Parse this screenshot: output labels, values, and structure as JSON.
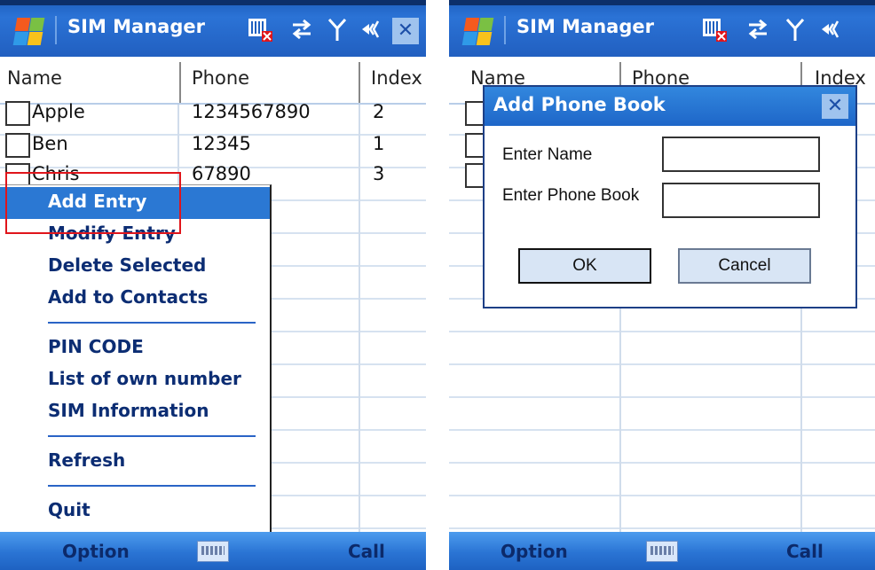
{
  "app_title": "SIM Manager",
  "columns": [
    "Name",
    "Phone",
    "Index"
  ],
  "rows": [
    {
      "name": "Apple",
      "phone": "1234567890",
      "index": "2"
    },
    {
      "name": "Ben",
      "phone": "12345",
      "index": "1"
    },
    {
      "name": "Chris",
      "phone": "67890",
      "index": "3"
    }
  ],
  "menu": {
    "items": [
      "Add Entry",
      "Modify Entry",
      "Delete Selected",
      "Add to Contacts",
      "PIN CODE",
      "List of own number",
      "SIM Information",
      "Refresh",
      "Quit"
    ],
    "selected": "Add Entry"
  },
  "softkeys": {
    "left": "Option",
    "right": "Call"
  },
  "dialog": {
    "title": "Add Phone Book",
    "name_label": "Enter Name",
    "phone_label": "Enter Phone Book",
    "name_value": "",
    "phone_value": "",
    "ok_label": "OK",
    "cancel_label": "Cancel"
  },
  "colors": {
    "accent": "#2b78d3",
    "highlight_box": "#e0151b",
    "menu_text": "#0c2d73"
  },
  "icons": [
    "windows-logo-icon",
    "sim-card-icon",
    "connection-arrows-icon",
    "signal-antenna-icon",
    "speaker-icon",
    "close-icon",
    "keyboard-icon"
  ]
}
